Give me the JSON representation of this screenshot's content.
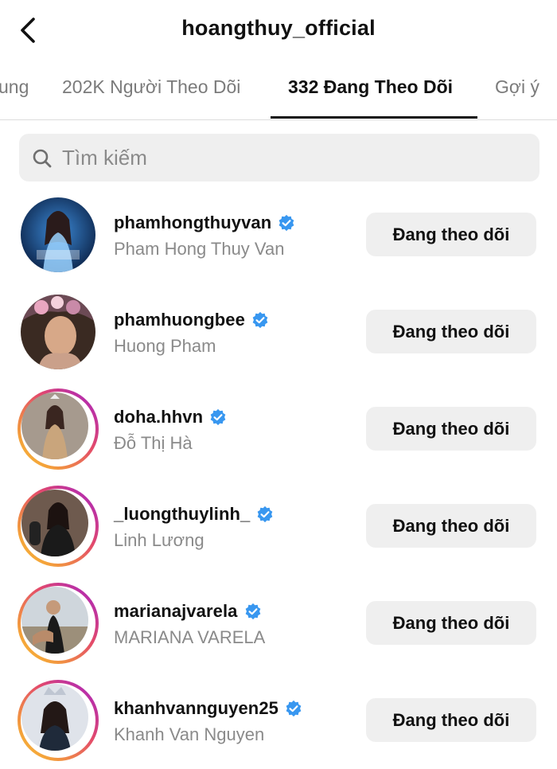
{
  "header": {
    "title": "hoangthuy_official"
  },
  "tabs": [
    {
      "label": "ung"
    },
    {
      "label": "202K Người Theo Dõi"
    },
    {
      "label": "332 Đang Theo Dõi",
      "active": true
    },
    {
      "label": "Gợi ý"
    }
  ],
  "search": {
    "placeholder": "Tìm kiếm",
    "value": ""
  },
  "users": [
    {
      "username": "phamhongthuyvan",
      "name": "Pham Hong Thuy Van",
      "button": "Đang theo dõi",
      "story_ring": false
    },
    {
      "username": "phamhuongbee",
      "name": "Huong Pham",
      "button": "Đang theo dõi",
      "story_ring": false
    },
    {
      "username": "doha.hhvn",
      "name": "Đỗ Thị Hà",
      "button": "Đang theo dõi",
      "story_ring": true
    },
    {
      "username": "_luongthuylinh_",
      "name": "Linh Lương",
      "button": "Đang theo dõi",
      "story_ring": true
    },
    {
      "username": "marianajvarela",
      "name": "MARIANA VARELA",
      "button": "Đang theo dõi",
      "story_ring": true
    },
    {
      "username": "khanhvannguyen25",
      "name": "Khanh Van Nguyen",
      "button": "Đang theo dõi",
      "story_ring": true
    }
  ],
  "colors": {
    "verified": "#3897f0",
    "button_bg": "#efefef",
    "secondary_text": "#8a8a8a"
  }
}
